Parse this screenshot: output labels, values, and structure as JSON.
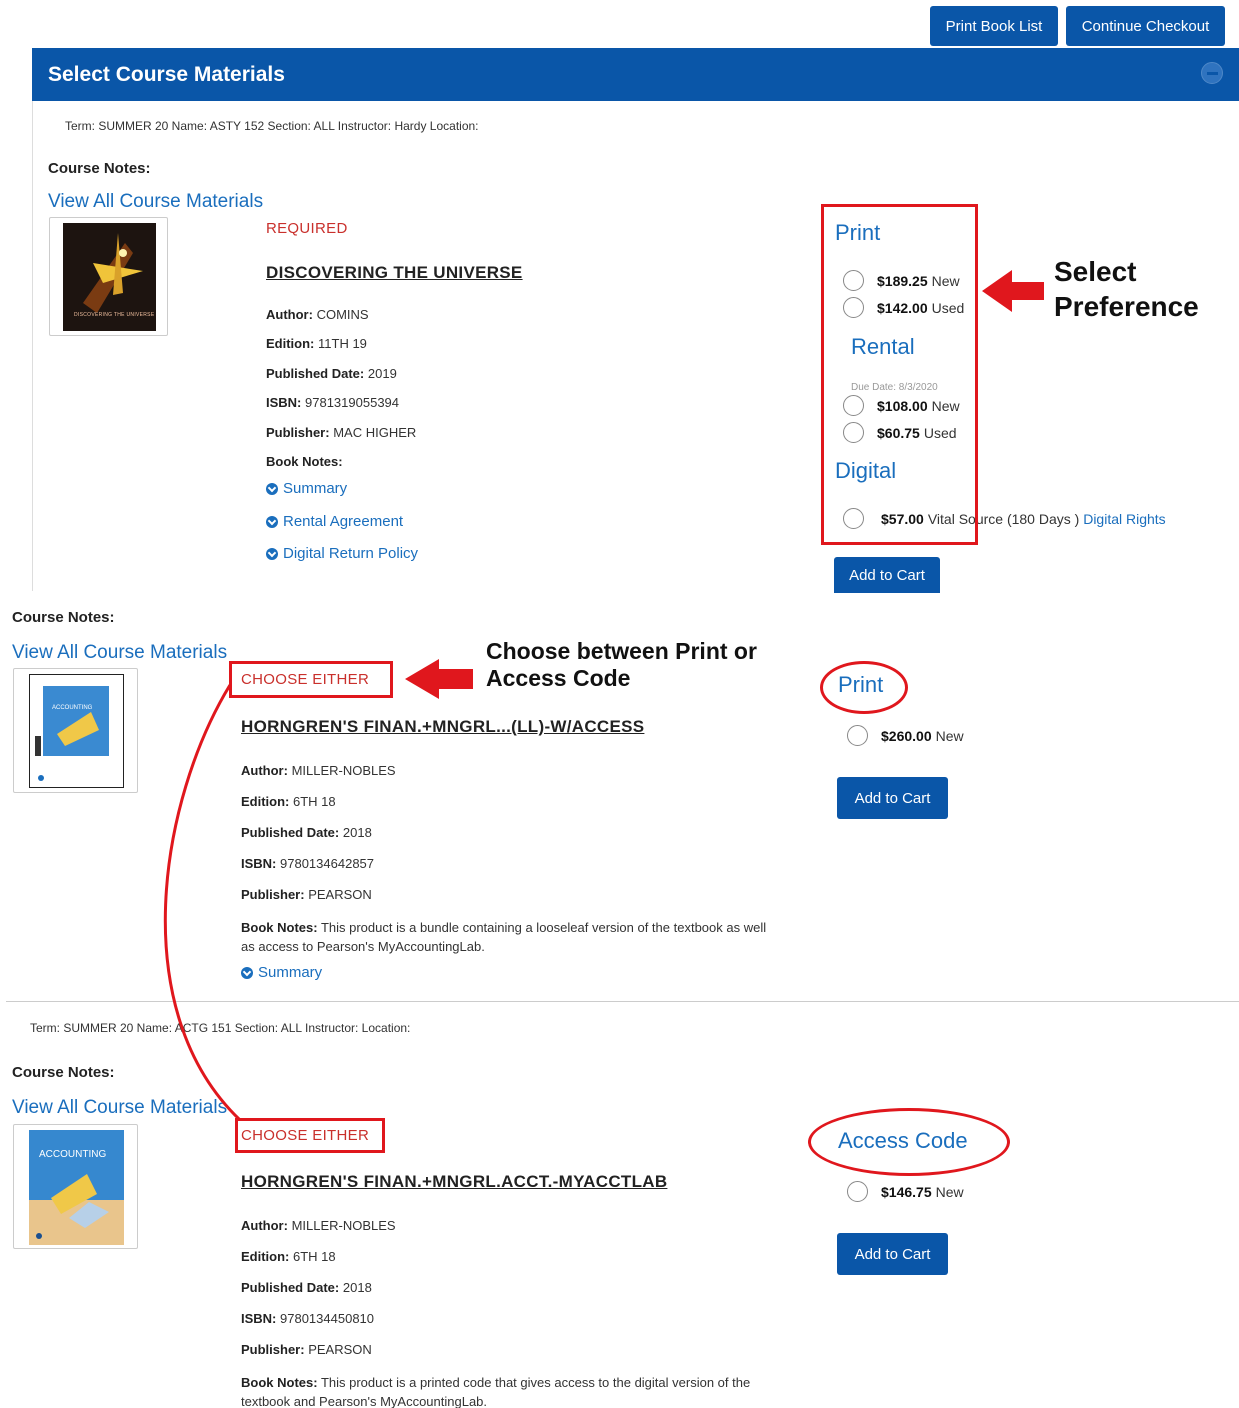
{
  "toolbar": {
    "print_book_list": "Print Book List",
    "continue_checkout": "Continue Checkout"
  },
  "header": {
    "title": "Select Course Materials"
  },
  "course1": {
    "term_line": "Term: SUMMER 20 Name: ASTY 152 Section: ALL Instructor: Hardy Location:",
    "course_notes": "Course Notes:",
    "view_all": "View All Course Materials",
    "requirement": "REQUIRED",
    "title": "DISCOVERING THE UNIVERSE",
    "author_label": "Author:",
    "author": "COMINS",
    "edition_label": "Edition:",
    "edition": "11TH 19",
    "published_label": "Published Date:",
    "published": "2019",
    "isbn_label": "ISBN:",
    "isbn": "9781319055394",
    "publisher_label": "Publisher:",
    "publisher": "MAC HIGHER",
    "book_notes_label": "Book Notes:",
    "links": [
      "Summary",
      "Rental Agreement",
      "Digital Return Policy"
    ],
    "print_head": "Print",
    "print_new_price": "$189.25",
    "print_new_cond": "New",
    "print_used_price": "$142.00",
    "print_used_cond": "Used",
    "rental_head": "Rental",
    "due_date": "Due Date: 8/3/2020",
    "rental_new_price": "$108.00",
    "rental_new_cond": "New",
    "rental_used_price": "$60.75",
    "rental_used_cond": "Used",
    "digital_head": "Digital",
    "digital_price": "$57.00",
    "digital_desc": "Vital Source (180 Days )",
    "digital_rights": "Digital Rights",
    "add_to_cart": "Add to Cart",
    "cover_text": "DISCOVERING THE UNIVERSE"
  },
  "course2": {
    "course_notes": "Course Notes:",
    "view_all": "View All Course Materials",
    "requirement": "CHOOSE EITHER",
    "title": "HORNGREN'S FINAN.+MNGRL...(LL)-W/ACCESS",
    "author_label": "Author:",
    "author": "MILLER-NOBLES",
    "edition_label": "Edition:",
    "edition": "6TH 18",
    "published_label": "Published Date:",
    "published": "2018",
    "isbn_label": "ISBN:",
    "isbn": "9780134642857",
    "publisher_label": "Publisher:",
    "publisher": "PEARSON",
    "book_notes_label": "Book Notes:",
    "book_notes": "This product is a bundle containing a looseleaf version of the textbook as well",
    "book_notes_2": "as access to Pearson's MyAccountingLab.",
    "summary": "Summary",
    "print_head": "Print",
    "price": "$260.00",
    "cond": "New",
    "add_to_cart": "Add to Cart",
    "cover_text": "ACCOUNTING"
  },
  "course3": {
    "term_line": "Term: SUMMER 20 Name: ACTG 151 Section: ALL Instructor: Location:",
    "course_notes": "Course Notes:",
    "view_all": "View All Course Materials",
    "requirement": "CHOOSE EITHER",
    "title": "HORNGREN'S FINAN.+MNGRL.ACCT.-MYACCTLAB",
    "author_label": "Author:",
    "author": "MILLER-NOBLES",
    "edition_label": "Edition:",
    "edition": "6TH 18",
    "published_label": "Published Date:",
    "published": "2018",
    "isbn_label": "ISBN:",
    "isbn": "9780134450810",
    "publisher_label": "Publisher:",
    "publisher": "PEARSON",
    "book_notes_label": "Book Notes:",
    "book_notes": "This product is a printed code that gives access to the digital version of the",
    "book_notes_2": "textbook and Pearson's MyAccountingLab.",
    "access_head": "Access Code",
    "price": "$146.75",
    "cond": "New",
    "add_to_cart": "Add to Cart",
    "cover_text": "ACCOUNTING"
  },
  "annotations": {
    "select_pref_1": "Select",
    "select_pref_2": "Preference",
    "choose_1": "Choose between Print or",
    "choose_2": "Access Code"
  },
  "colors": {
    "brand_blue": "#0a56a8",
    "link_blue": "#1a6ebd",
    "annotation_red": "#e0171d",
    "required_red": "#c9302c"
  }
}
